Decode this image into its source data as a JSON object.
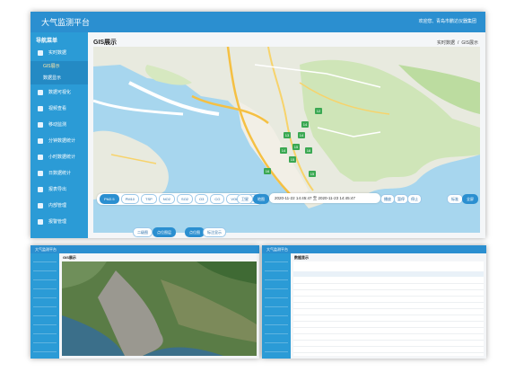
{
  "header": {
    "title": "大气监测平台",
    "welcome": "欢迎您,",
    "org": "青岛市鹏达仪器集团"
  },
  "sidebar": {
    "menu_title": "导航菜单",
    "items": [
      {
        "label": "实时数据",
        "icon": "monitor-icon"
      },
      {
        "label": "GIS展示",
        "sub": true,
        "active": true
      },
      {
        "label": "数据显示",
        "sub": true
      },
      {
        "label": "数据可视化",
        "icon": "chart-icon"
      },
      {
        "label": "视频查看",
        "icon": "video-icon"
      },
      {
        "label": "移动监测",
        "icon": "car-icon"
      },
      {
        "label": "分钟数据统计",
        "icon": "stats-icon"
      },
      {
        "label": "小时数据统计",
        "icon": "stats-icon"
      },
      {
        "label": "日数据统计",
        "icon": "calendar-icon"
      },
      {
        "label": "报表导出",
        "icon": "file-icon"
      },
      {
        "label": "内部管理",
        "icon": "gear-icon"
      },
      {
        "label": "报警管理",
        "icon": "alarm-icon"
      }
    ]
  },
  "main": {
    "section_title": "GIS展示",
    "breadcrumb": [
      "实时数据",
      "/",
      "GIS展示"
    ],
    "pollutants": [
      "PM2.5",
      "PM10",
      "TSP",
      "NO2",
      "SO2",
      "O3",
      "CO",
      "VOL",
      "AQI"
    ],
    "map_toggle": [
      "卫星",
      "地图"
    ],
    "time_range": {
      "start": "2020-11-22 14:45:47",
      "sep": "至",
      "end": "2020-11-23 14:45:47"
    },
    "time_buttons": [
      "播放",
      "暂停",
      "停止"
    ],
    "right_buttons": [
      "标准",
      "全屏"
    ],
    "layer_buttons": [
      "二级图",
      "点位图层"
    ],
    "marker_buttons": [
      "点位图",
      "标注显示"
    ],
    "markers": [
      "12",
      "14",
      "14",
      "13",
      "15",
      "18",
      "15",
      "14",
      "15",
      "16"
    ]
  },
  "mini_left": {
    "title": "大气监测平台",
    "section": "GIS展示"
  },
  "mini_right": {
    "title": "大气监测平台",
    "section": "数据显示"
  },
  "colors": {
    "primary": "#2b8fd0",
    "sidebar": "#2b9bd6",
    "marker": "#3aa852"
  }
}
